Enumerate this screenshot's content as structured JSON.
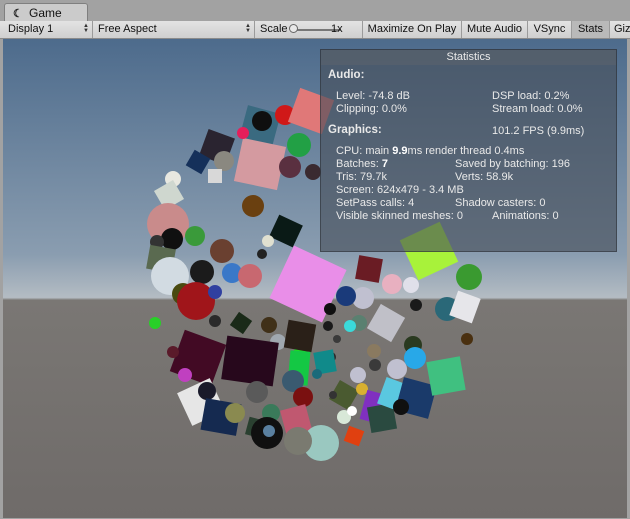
{
  "tab": {
    "title": "Game"
  },
  "toolbar": {
    "display": "Display 1",
    "aspect": "Free Aspect",
    "scale_label": "Scale",
    "scale_value": "1x",
    "maximize": "Maximize On Play",
    "mute": "Mute Audio",
    "vsync": "VSync",
    "stats": "Stats",
    "gizmos": "Gizmos"
  },
  "stats": {
    "title": "Statistics",
    "audio_header": "Audio:",
    "level": "Level: -74.8 dB",
    "clipping": "Clipping: 0.0%",
    "dsp": "DSP load: 0.2%",
    "stream": "Stream load: 0.0%",
    "graphics_header": "Graphics:",
    "fps": "101.2 FPS (9.9ms)",
    "cpu_prefix": "CPU: main ",
    "cpu_main": "9.9",
    "cpu_suffix": "ms  render thread 0.4ms",
    "batches_prefix": "Batches: ",
    "batches": "7",
    "saved": "Saved by batching: 196",
    "tris": "Tris: 79.7k",
    "verts": "Verts: 58.9k",
    "screen": "Screen: 624x479 - 3.4 MB",
    "setpass": "SetPass calls: 4",
    "shadow": "Shadow casters: 0",
    "skinned": "Visible skinned meshes: 0",
    "animations": "Animations: 0"
  }
}
